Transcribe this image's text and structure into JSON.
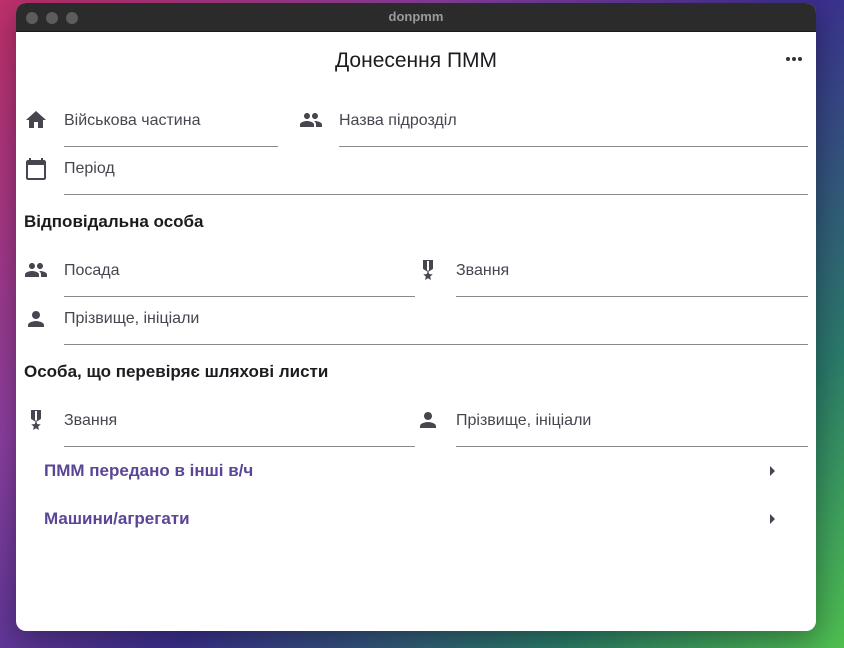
{
  "window": {
    "title": "donpmm"
  },
  "app": {
    "title": "Донесення ПММ",
    "menu_icon": "more-horiz-icon"
  },
  "fields": {
    "military_unit": {
      "placeholder": "Військова частина",
      "icon": "home-icon"
    },
    "subdivision": {
      "placeholder": "Назва підрозділ",
      "icon": "people-icon"
    },
    "period": {
      "placeholder": "Період",
      "icon": "calendar-icon"
    }
  },
  "responsible": {
    "heading": "Відповідальна особа",
    "position": {
      "placeholder": "Посада",
      "icon": "people-icon"
    },
    "rank": {
      "placeholder": "Звання",
      "icon": "military-medal-icon"
    },
    "name": {
      "placeholder": "Прізвище, ініціали",
      "icon": "person-icon"
    }
  },
  "checker": {
    "heading": "Особа, що перевіряє шляхові листи",
    "rank": {
      "placeholder": "Звання",
      "icon": "military-medal-icon"
    },
    "name": {
      "placeholder": "Прізвище, ініціали",
      "icon": "person-icon"
    }
  },
  "links": [
    {
      "label": "ПММ передано в інші в/ч",
      "icon": "arrow-right-icon"
    },
    {
      "label": "Машини/агрегати",
      "icon": "arrow-right-icon"
    }
  ],
  "colors": {
    "accent": "#5b4596",
    "titlebar": "#2b2b2b",
    "icon": "#45464f"
  }
}
